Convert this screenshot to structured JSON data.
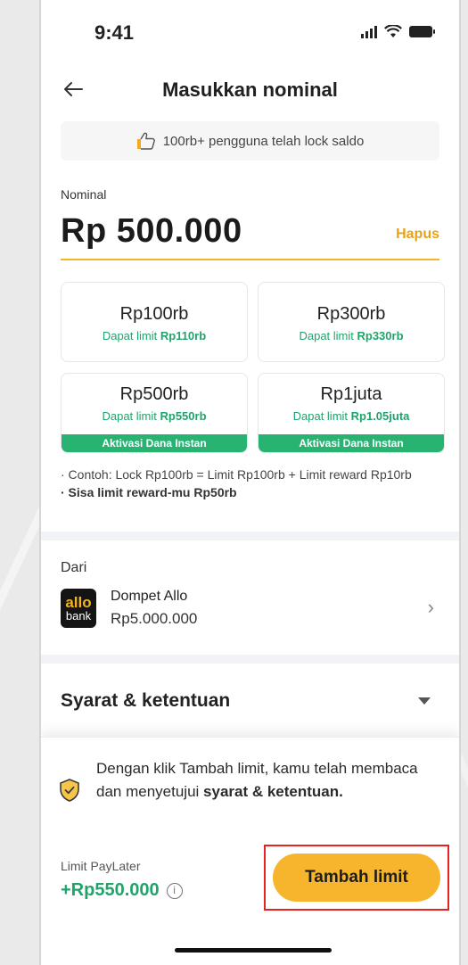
{
  "status_bar": {
    "time": "9:41"
  },
  "header": {
    "title": "Masukkan nominal"
  },
  "social_proof": {
    "text": "100rb+ pengguna telah lock saldo"
  },
  "nominal": {
    "label": "Nominal",
    "amount": "Rp 500.000",
    "clear_label": "Hapus"
  },
  "options": [
    {
      "amount": "Rp100rb",
      "limit_prefix": "Dapat limit ",
      "limit_value": "Rp110rb",
      "promo": ""
    },
    {
      "amount": "Rp300rb",
      "limit_prefix": "Dapat limit ",
      "limit_value": "Rp330rb",
      "promo": ""
    },
    {
      "amount": "Rp500rb",
      "limit_prefix": "Dapat limit ",
      "limit_value": "Rp550rb",
      "promo": "Aktivasi Dana Instan"
    },
    {
      "amount": "Rp1juta",
      "limit_prefix": "Dapat limit ",
      "limit_value": "Rp1.05juta",
      "promo": "Aktivasi Dana Instan"
    }
  ],
  "notes": {
    "line1": "· Contoh: Lock Rp100rb = Limit Rp100rb + Limit reward Rp10rb",
    "line2": "· Sisa limit reward-mu Rp50rb"
  },
  "source": {
    "label": "Dari",
    "logo_top": "allo",
    "logo_bottom": "bank",
    "name": "Dompet Allo",
    "balance": "Rp5.000.000"
  },
  "terms": {
    "title": "Syarat & ketentuan"
  },
  "bottom": {
    "agree_prefix": "Dengan klik Tambah limit, kamu telah membaca dan menyetujui ",
    "agree_bold": "syarat & ketentuan.",
    "paylater_label": "Limit PayLater",
    "paylater_value": "+Rp550.000",
    "info_glyph": "i",
    "cta_label": "Tambah limit"
  },
  "colors": {
    "accent": "#f7b52d",
    "green": "#22a36b",
    "highlight_border": "#e52420"
  }
}
